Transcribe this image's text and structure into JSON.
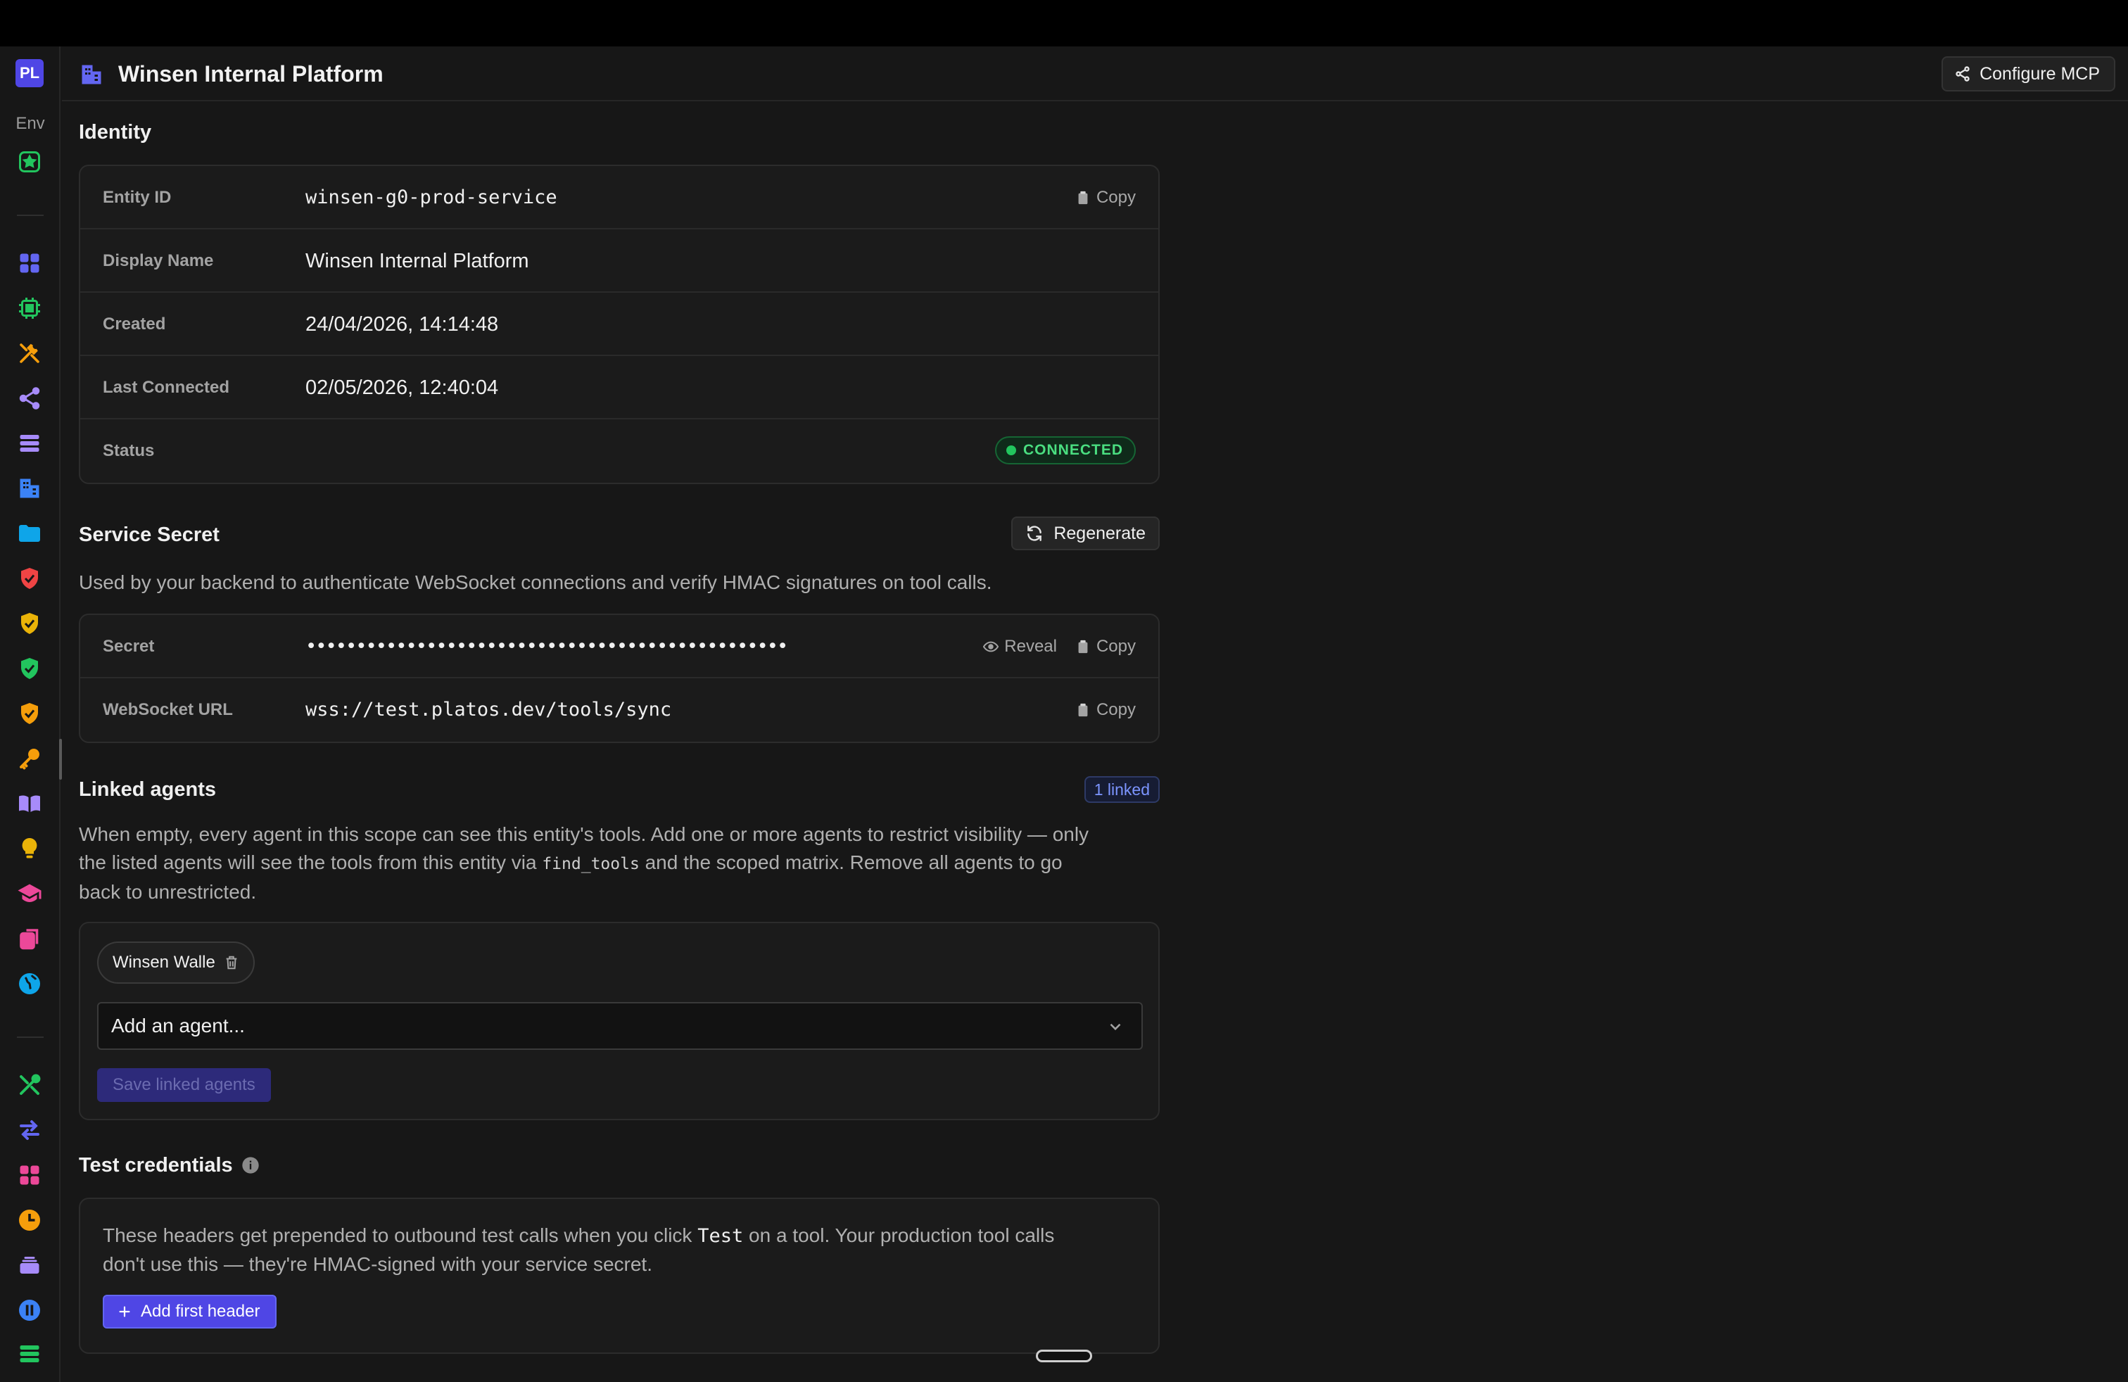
{
  "rail": {
    "logo": "PL",
    "env_label": "Env",
    "colors": {
      "indigo": "#6366f1",
      "green": "#22c55e",
      "orange": "#f59e0b",
      "purple": "#a78bfa",
      "blue": "#3b82f6",
      "sky": "#0ea5e9",
      "red": "#ef4444",
      "yellow": "#eab308",
      "pink": "#ec4899"
    }
  },
  "header": {
    "title": "Winsen Internal Platform",
    "configure_label": "Configure MCP"
  },
  "identity": {
    "title": "Identity",
    "copy_label": "Copy",
    "rows": [
      {
        "label": "Entity ID",
        "value": "winsen-g0-prod-service"
      },
      {
        "label": "Display Name",
        "value": "Winsen Internal Platform"
      },
      {
        "label": "Created",
        "value": "24/04/2026, 14:14:48"
      },
      {
        "label": "Last Connected",
        "value": "02/05/2026, 12:40:04"
      },
      {
        "label": "Status",
        "value": "CONNECTED"
      }
    ],
    "status_color": "#22c55e"
  },
  "secret": {
    "title": "Service Secret",
    "regenerate_label": "Regenerate",
    "description": "Used by your backend to authenticate WebSocket connections and verify HMAC signatures on tool calls.",
    "secret_label": "Secret",
    "secret_value": "••••••••••••••••••••••••••••••••••••••••••••••••",
    "reveal_label": "Reveal",
    "copy_label": "Copy",
    "ws_label": "WebSocket URL",
    "ws_value": "wss://test.platos.dev/tools/sync"
  },
  "linked": {
    "title": "Linked agents",
    "badge": "1 linked",
    "desc_1": "When empty, every agent in this scope can see this entity's tools. Add one or more agents to restrict visibility — only",
    "desc_2a": "the listed agents will see the tools from this entity via ",
    "desc_code": "find_tools",
    "desc_2b": " and the scoped matrix. Remove all agents to go",
    "desc_3": "back to unrestricted.",
    "chip": "Winsen Walle",
    "select_placeholder": "Add an agent...",
    "save_label": "Save linked agents"
  },
  "test": {
    "title": "Test credentials",
    "desc_1a": "These headers get prepended to outbound test calls when you click ",
    "desc_code": "Test",
    "desc_1b": " on a tool. Your production tool calls",
    "desc_2": "don't use this — they're HMAC-signed with your service secret.",
    "add_label": "Add first header"
  }
}
